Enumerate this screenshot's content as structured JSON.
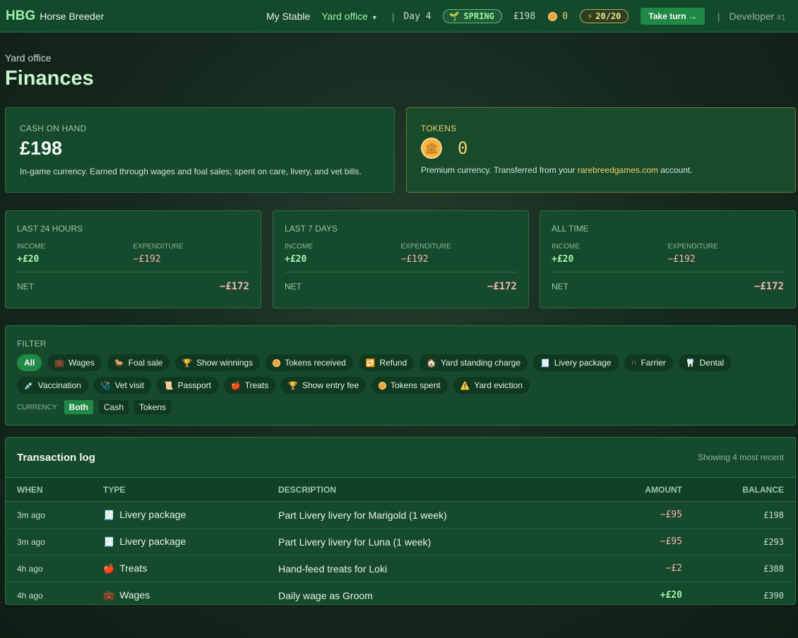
{
  "header": {
    "logo_short": "HBG",
    "logo_name": "Horse Breeder",
    "nav_stable": "My Stable",
    "nav_yard": "Yard office",
    "sep": "|",
    "day": "Day 4",
    "season": "SPRING",
    "cash": "£198",
    "tokens": "0",
    "energy": "20/20",
    "take_turn": "Take turn →",
    "user": "Developer",
    "user_num": "#1"
  },
  "page": {
    "breadcrumb": "Yard office",
    "title": "Finances"
  },
  "cash_card": {
    "label": "CASH ON HAND",
    "value": "£198",
    "desc": "In-game currency. Earned through wages and foal sales; spent on care, livery, and vet bills."
  },
  "token_card": {
    "label": "TOKENS",
    "value": "0",
    "desc_pre": "Premium currency. Transferred from your ",
    "link": "rarebreedgames.com",
    "desc_post": " account."
  },
  "stats": [
    {
      "heading": "LAST 24 HOURS",
      "income_label": "INCOME",
      "income": "+£20",
      "exp_label": "EXPENDITURE",
      "exp": "−£192",
      "net_label": "NET",
      "net": "−£172"
    },
    {
      "heading": "LAST 7 DAYS",
      "income_label": "INCOME",
      "income": "+£20",
      "exp_label": "EXPENDITURE",
      "exp": "−£192",
      "net_label": "NET",
      "net": "−£172"
    },
    {
      "heading": "ALL TIME",
      "income_label": "INCOME",
      "income": "+£20",
      "exp_label": "EXPENDITURE",
      "exp": "−£192",
      "net_label": "NET",
      "net": "−£172"
    }
  ],
  "filter": {
    "label": "FILTER",
    "chips": [
      "All",
      "Wages",
      "Foal sale",
      "Show winnings",
      "Tokens received",
      "Refund",
      "Yard standing charge",
      "Livery package",
      "Farrier",
      "Dental",
      "Vaccination",
      "Vet visit",
      "Passport",
      "Treats",
      "Show entry fee",
      "Tokens spent",
      "Yard eviction"
    ],
    "currency_label": "CURRENCY",
    "currency": [
      "Both",
      "Cash",
      "Tokens"
    ]
  },
  "log": {
    "title": "Transaction log",
    "count": "Showing 4 most recent",
    "columns": [
      "WHEN",
      "TYPE",
      "DESCRIPTION",
      "AMOUNT",
      "BALANCE"
    ],
    "rows": [
      {
        "when": "3m ago",
        "type": "Livery package",
        "desc": "Part Livery livery for Marigold (1 week)",
        "amount": "−£95",
        "balance": "£198"
      },
      {
        "when": "3m ago",
        "type": "Livery package",
        "desc": "Part Livery livery for Luna (1 week)",
        "amount": "−£95",
        "balance": "£293"
      },
      {
        "when": "4h ago",
        "type": "Treats",
        "desc": "Hand-feed treats for Loki",
        "amount": "−£2",
        "balance": "£388"
      },
      {
        "when": "4h ago",
        "type": "Wages",
        "desc": "Daily wage as Groom",
        "amount": "+£20",
        "balance": "£390"
      }
    ]
  }
}
